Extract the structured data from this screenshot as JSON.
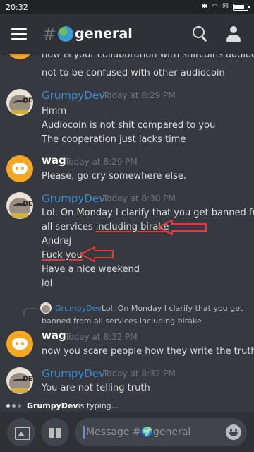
{
  "status": {
    "time": "20:32",
    "icons": [
      "bluetooth-icon",
      "wifi-icon",
      "sim-icon",
      "battery-icon"
    ],
    "battery_level": 0.7
  },
  "header": {
    "channel": "general",
    "hash": "#"
  },
  "messages": [
    {
      "partial": true,
      "lines": [
        "how is your collaboration with shitcoins audiocoin,",
        "not to be confused with other audiocoin"
      ]
    },
    {
      "author": "GrumpyDev",
      "time": "Today at 8:29 PM",
      "lines": [
        "Hmm",
        "Audiocoin is not shit compared to you",
        "The cooperation just lacks time"
      ]
    },
    {
      "author": "wag",
      "time": "Today at 8:29 PM",
      "lines": [
        "Please, go cry somewhere else."
      ]
    },
    {
      "author": "GrumpyDev",
      "time": "Today at 8:30 PM",
      "lines": [
        "Lol. On Monday I clarify that you get banned from",
        "all services ",
        "including birake",
        "Andrej",
        "Fuck you",
        "Have a nice weekend",
        "lol"
      ]
    },
    {
      "reply_to": {
        "author": "GrumpyDev",
        "text_1": "Lol. On Monday I clarify that you get",
        "text_2": "banned from all services including birake"
      }
    },
    {
      "author": "wag",
      "time": "Today at 8:32 PM",
      "lines": [
        "now you scare people how they write the truth"
      ]
    },
    {
      "author": "GrumpyDev",
      "time": "Today at 8:32 PM",
      "lines": [
        "You are not telling truth"
      ]
    }
  ],
  "typing": {
    "user": "GrumpyDev",
    "suffix": " is typing..."
  },
  "composer": {
    "placeholder": "Message #🌍general"
  },
  "colors": {
    "annotation": "#e53935",
    "author_link": "#3a8bd0"
  }
}
